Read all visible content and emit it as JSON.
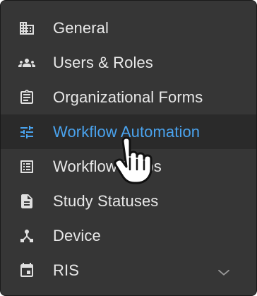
{
  "menu": {
    "items": [
      {
        "label": "General",
        "icon": "building-icon",
        "active": false
      },
      {
        "label": "Users & Roles",
        "icon": "group-icon",
        "active": false
      },
      {
        "label": "Organizational Forms",
        "icon": "clipboard-icon",
        "active": false
      },
      {
        "label": "Workflow Automation",
        "icon": "tune-icon",
        "active": true
      },
      {
        "label": "Workflow Steps",
        "icon": "list-icon",
        "active": false
      },
      {
        "label": "Study Statuses",
        "icon": "document-icon",
        "active": false
      },
      {
        "label": "Device",
        "icon": "device-hub-icon",
        "active": false
      },
      {
        "label": "RIS",
        "icon": "calendar-icon",
        "active": false
      }
    ],
    "expand_icon": "chevron-down-icon"
  },
  "colors": {
    "background": "#363636",
    "active_background": "#2a2a2a",
    "text": "#e8e8e8",
    "active_text": "#4aa3ee",
    "icon": "#e0e0e0"
  },
  "cursor": "hand-pointer-cursor"
}
